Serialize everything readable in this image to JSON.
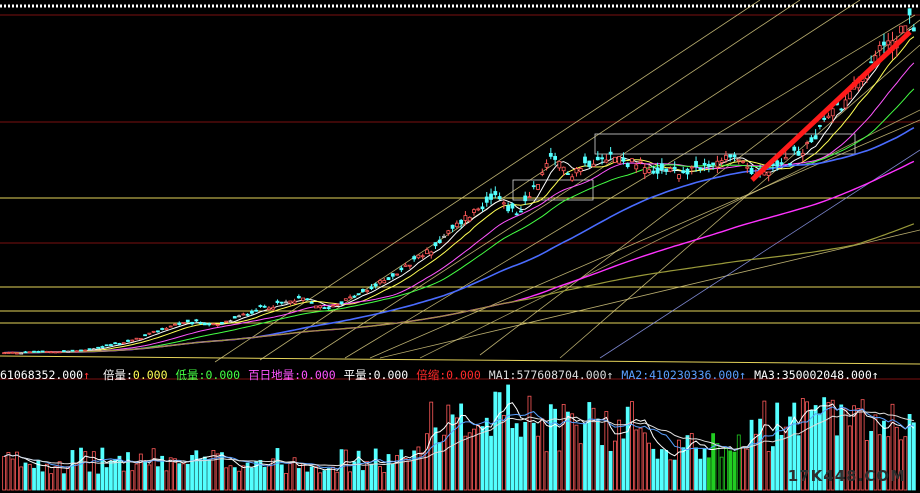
{
  "colors": {
    "background": "#000000",
    "up": "#ff5a5a",
    "down": "#54ffff",
    "flat": "#dcdcdc",
    "gridline": "#7a1010",
    "support": "#e5d35a",
    "ma1": "#ffffff",
    "ma2": "#ffff55",
    "ma3": "#ff55ff",
    "ma4": "#44ff44",
    "ma5": "#4a6cff",
    "ma6": "#ff33ff",
    "ma7": "#99993a",
    "trend": "#ff1a1a",
    "neutral_volume": "#22cc22"
  },
  "volume_bar": {
    "value": "61068352.000",
    "items": [
      {
        "label": "倍量:",
        "value": "0.000",
        "color": "#ffffff",
        "value_color": "#ffff55"
      },
      {
        "label": "低量:",
        "value": "0.000",
        "color": "#44ff44",
        "value_color": "#44ff44"
      },
      {
        "label": "百日地量:",
        "value": "0.000",
        "color": "#ff55ff",
        "value_color": "#ff55ff"
      },
      {
        "label": "平量:",
        "value": "0.000",
        "color": "#ffffff",
        "value_color": "#ffffff"
      },
      {
        "label": "倍缩:",
        "value": "0.000",
        "color": "#ff2a2a",
        "value_color": "#ff2a2a"
      },
      {
        "label": "MA1:",
        "value": "577608704.000",
        "color": "#dddddd",
        "value_color": "#dddddd"
      },
      {
        "label": "MA2:",
        "value": "410230336.000",
        "color": "#5aa0ff",
        "value_color": "#5aa0ff"
      },
      {
        "label": "MA3:",
        "value": "350002048.000",
        "color": "#ffffff",
        "value_color": "#ffffff"
      }
    ],
    "arrow": "↑"
  },
  "watermark": "17K448.COM",
  "chart_data": [
    {
      "type": "candlestick",
      "title": "",
      "overlays": [
        "moving averages",
        "gann fan lines",
        "horizontal support lines",
        "trend line"
      ],
      "price_profile": [
        [
          0,
          3.0
        ],
        [
          18,
          3.2
        ],
        [
          30,
          4.2
        ],
        [
          40,
          5.8
        ],
        [
          45,
          6.0
        ],
        [
          50,
          5.7
        ],
        [
          60,
          7.4
        ],
        [
          70,
          8.3
        ],
        [
          75,
          7.3
        ],
        [
          85,
          9.1
        ],
        [
          92,
          10.9
        ],
        [
          100,
          13.2
        ],
        [
          108,
          16.3
        ],
        [
          115,
          18.4
        ],
        [
          120,
          16.5
        ],
        [
          128,
          21.8
        ],
        [
          133,
          20.8
        ],
        [
          140,
          22.6
        ],
        [
          148,
          21.5
        ],
        [
          155,
          20.6
        ],
        [
          162,
          21.2
        ],
        [
          170,
          22.0
        ],
        [
          178,
          20.5
        ],
        [
          188,
          23.2
        ],
        [
          196,
          27.5
        ],
        [
          204,
          32.0
        ],
        [
          212,
          35.5
        ]
      ],
      "bars": 214,
      "grid": "horizontal",
      "legend": "none"
    },
    {
      "type": "bar",
      "title": "Volume",
      "series": [
        {
          "name": "MA1",
          "values": [
            577608704
          ]
        },
        {
          "name": "MA2",
          "values": [
            410230336
          ]
        },
        {
          "name": "MA3",
          "values": [
            350002048
          ]
        }
      ],
      "current": 61068352,
      "legend": "top-left"
    }
  ]
}
